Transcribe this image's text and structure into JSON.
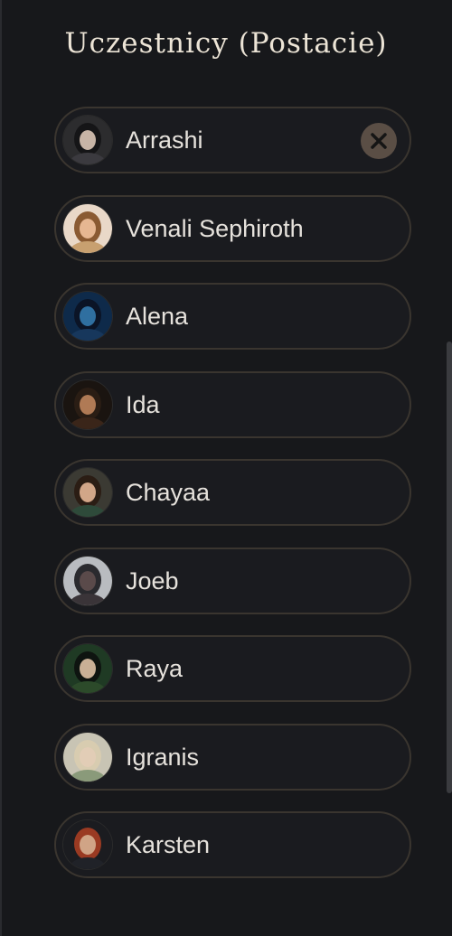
{
  "panel": {
    "title": "Uczestnicy (Postacie)"
  },
  "participants": [
    {
      "name": "Arrashi",
      "avatar_icon": "portrait-arrashi-icon",
      "bg": "#2c2c2e",
      "hair": "#151517",
      "skin": "#c7b4a6",
      "body": "#3b3a3f",
      "show_remove": true
    },
    {
      "name": "Venali Sephiroth",
      "avatar_icon": "portrait-venali-icon",
      "bg": "#e9d8c8",
      "hair": "#8a5a32",
      "skin": "#e6b792",
      "body": "#c8a070",
      "show_remove": false
    },
    {
      "name": "Alena",
      "avatar_icon": "portrait-alena-icon",
      "bg": "#0e2a4a",
      "hair": "#0b1426",
      "skin": "#2f6fa0",
      "body": "#17375c",
      "show_remove": false
    },
    {
      "name": "Ida",
      "avatar_icon": "portrait-ida-icon",
      "bg": "#1a1410",
      "hair": "#2a1d14",
      "skin": "#b07a55",
      "body": "#3a2519",
      "show_remove": false
    },
    {
      "name": "Chayaa",
      "avatar_icon": "portrait-chayaa-icon",
      "bg": "#3b3a33",
      "hair": "#2b1d14",
      "skin": "#d2a688",
      "body": "#2e4a3a",
      "show_remove": false
    },
    {
      "name": "Joeb",
      "avatar_icon": "portrait-joeb-icon",
      "bg": "#b9bcc0",
      "hair": "#2a2a2e",
      "skin": "#5a4a4a",
      "body": "#3a3438",
      "show_remove": false
    },
    {
      "name": "Raya",
      "avatar_icon": "portrait-raya-icon",
      "bg": "#1f3a24",
      "hair": "#0e1410",
      "skin": "#c9b096",
      "body": "#2c4a2a",
      "show_remove": false
    },
    {
      "name": "Igranis",
      "avatar_icon": "portrait-igranis-icon",
      "bg": "#c8c4b4",
      "hair": "#d8ccb0",
      "skin": "#e2cdb6",
      "body": "#8a9a7a",
      "show_remove": false
    },
    {
      "name": "Karsten",
      "avatar_icon": "portrait-karsten-icon",
      "bg": "#1b1c20",
      "hair": "#9a3a22",
      "skin": "#d0a486",
      "body": "#202228",
      "show_remove": false
    }
  ],
  "remove_button": {
    "icon": "close-icon",
    "color": "#5a4e45",
    "glyph_color": "#151515"
  },
  "colors": {
    "background": "#17181b",
    "pill_border": "#3a352f",
    "text": "#e6e2dc",
    "title": "#ece4d6"
  }
}
